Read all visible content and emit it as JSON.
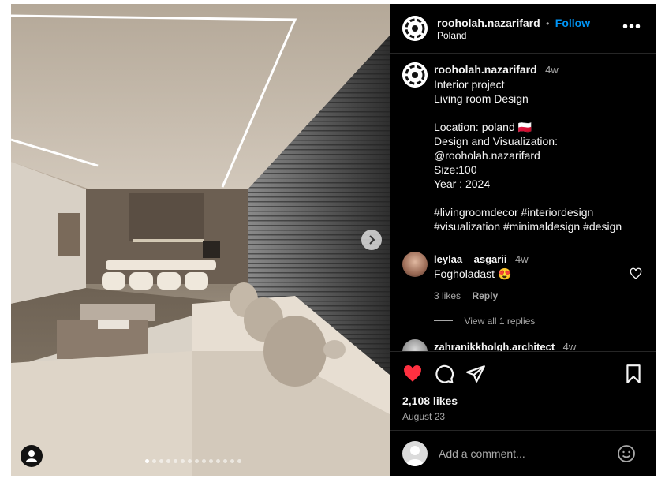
{
  "post": {
    "username": "rooholah.nazarifard",
    "follow_label": "Follow",
    "separator": "•",
    "location": "Poland",
    "more_label": "•••"
  },
  "caption": {
    "username": "rooholah.nazarifard",
    "time": "4w",
    "text": "Interior project\nLiving room Design\n\nLocation: poland 🇵🇱\nDesign and Visualization:\n@rooholah.nazarifard\nSize:100\nYear : 2024\n\n#livingroomdecor #interiordesign\n#visualization #minimaldesign #design"
  },
  "comments": [
    {
      "username": "leylaa__asgarii",
      "time": "4w",
      "text": "Fogholadast 😍",
      "likes": "3 likes",
      "reply_label": "Reply",
      "view_replies": "View all 1 replies"
    },
    {
      "username": "zahranikkholgh.architect",
      "time": "4w"
    }
  ],
  "stats": {
    "likes": "2,108 likes",
    "date": "August 23"
  },
  "add_comment": {
    "placeholder": "Add a comment..."
  },
  "carousel": {
    "dot_count": 14,
    "active_index": 0
  },
  "colors": {
    "accent": "#0095f6",
    "like": "#ff3040",
    "panel_bg": "#000000"
  },
  "icons": [
    "heart-icon",
    "comment-icon",
    "share-icon",
    "bookmark-icon",
    "emoji-icon",
    "next-arrow-icon",
    "user-tag-icon"
  ]
}
